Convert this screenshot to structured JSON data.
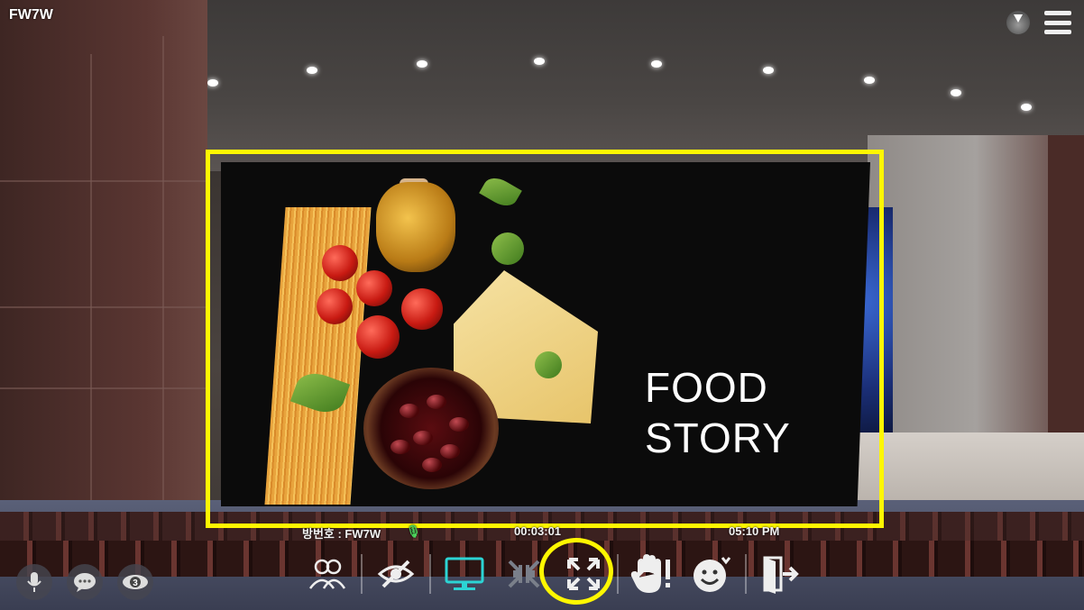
{
  "app": {
    "room_code": "FW7W"
  },
  "presentation": {
    "title_line1": "FOOD",
    "title_line2": "STORY"
  },
  "status": {
    "room_label": "방번호 : FW7W",
    "timer": "00:03:01",
    "clock": "05:10 PM"
  },
  "toolbar": {
    "items": [
      {
        "name": "participants",
        "icon": "people-icon"
      },
      {
        "name": "hide",
        "icon": "eye-slash-icon"
      },
      {
        "name": "screen-share",
        "icon": "monitor-icon",
        "active_color": "#2cd4d4"
      },
      {
        "name": "shrink",
        "icon": "collapse-icon"
      },
      {
        "name": "fullscreen",
        "icon": "expand-icon"
      },
      {
        "name": "raise-hand",
        "icon": "hand-raise-icon"
      },
      {
        "name": "emoji",
        "icon": "smile-icon"
      },
      {
        "name": "exit",
        "icon": "exit-door-icon"
      }
    ]
  },
  "left_controls": [
    {
      "name": "mic",
      "icon": "microphone-icon"
    },
    {
      "name": "chat",
      "icon": "chat-icon"
    },
    {
      "name": "viewers",
      "icon": "eye-count-icon",
      "count": "3"
    }
  ],
  "colors": {
    "highlight": "#fff700",
    "active": "#2cd4d4"
  }
}
